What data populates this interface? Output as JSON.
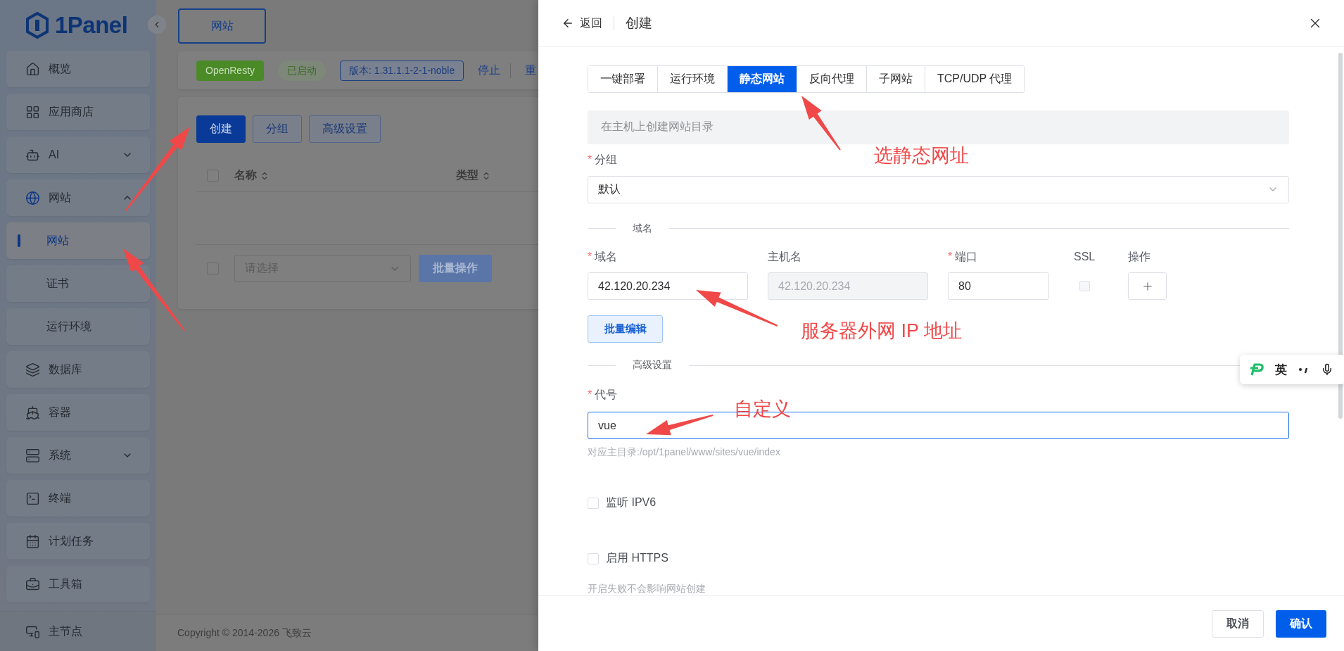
{
  "sidebar": {
    "logo": "1Panel",
    "items": [
      {
        "label": "概览"
      },
      {
        "label": "应用商店"
      },
      {
        "label": "AI",
        "expanded": false
      },
      {
        "label": "网站",
        "expanded": true,
        "children": [
          {
            "label": "网站",
            "selected": true
          },
          {
            "label": "证书",
            "selected": false
          },
          {
            "label": "运行环境",
            "selected": false
          }
        ]
      },
      {
        "label": "数据库"
      },
      {
        "label": "容器"
      },
      {
        "label": "系统",
        "expanded": false
      },
      {
        "label": "终端"
      },
      {
        "label": "计划任务"
      },
      {
        "label": "工具箱"
      }
    ],
    "footer_item": "主节点"
  },
  "main": {
    "page_tab": "网站",
    "status": {
      "app": "OpenResty",
      "state": "已启动",
      "version": "版本: 1.31.1.1-2-1-noble",
      "actions": [
        "停止",
        "重"
      ]
    },
    "toolbar": [
      {
        "label": "创建",
        "primary": true
      },
      {
        "label": "分组",
        "primary": false
      },
      {
        "label": "高级设置",
        "primary": false
      }
    ],
    "table": {
      "select_all_checked": false,
      "columns": [
        "名称",
        "类型"
      ]
    },
    "batch": {
      "checked": false,
      "placeholder": "请选择",
      "button": "批量操作"
    },
    "footer": "Copyright © 2014-2026 飞致云"
  },
  "drawer": {
    "back": "返回",
    "title": "创建",
    "tabs": [
      {
        "label": "一键部署",
        "selected": false
      },
      {
        "label": "运行环境",
        "selected": false
      },
      {
        "label": "静态网站",
        "selected": true
      },
      {
        "label": "反向代理",
        "selected": false
      },
      {
        "label": "子网站",
        "selected": false
      },
      {
        "label": "TCP/UDP 代理",
        "selected": false
      }
    ],
    "info": "在主机上创建网站目录",
    "group": {
      "mark": "*",
      "label": "分组",
      "value": "默认"
    },
    "domain_section": "域名",
    "domain_columns": [
      {
        "mark": "*",
        "label": "域名"
      },
      {
        "label": "主机名"
      },
      {
        "mark": "*",
        "label": "端口"
      },
      {
        "label": "SSL"
      },
      {
        "label": "操作"
      }
    ],
    "domain_row": {
      "domain": "42.120.20.234",
      "host": "42.120.20.234",
      "host_disabled": true,
      "port": "80",
      "ssl": false
    },
    "batch_edit": "批量编辑",
    "advanced_section": "高级设置",
    "alias": {
      "mark": "*",
      "label": "代号",
      "value": "vue",
      "hint": "对应主目录:/opt/1panel/www/sites/vue/index"
    },
    "options": [
      {
        "label": "监听 IPV6",
        "checked": false
      },
      {
        "label": "启用 HTTPS",
        "checked": false,
        "hint": "开启失败不会影响网站创建"
      }
    ],
    "cancel": "取消",
    "confirm": "确认"
  },
  "ime": {
    "mode": "英"
  },
  "annotations": [
    {
      "text": "选静态网址"
    },
    {
      "text": "服务器外网 IP 地址"
    },
    {
      "text": "自定义"
    }
  ]
}
